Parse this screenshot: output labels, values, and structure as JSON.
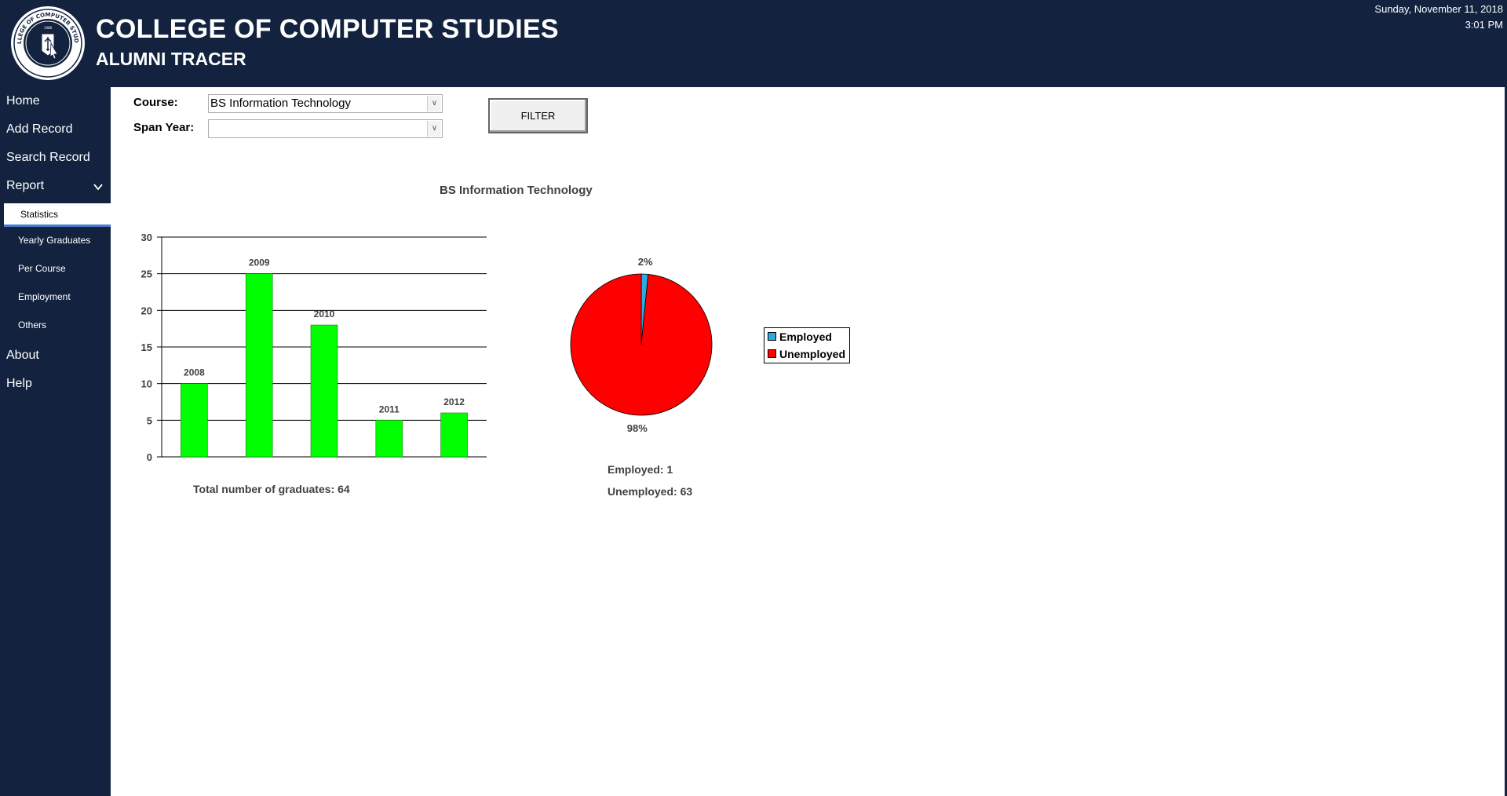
{
  "header": {
    "title": "COLLEGE OF COMPUTER STUDIES",
    "subtitle": "ALUMNI TRACER",
    "date": "Sunday, November 11, 2018",
    "time": "3:01 PM",
    "logo_text": "COLLEGE OF COMPUTER STUDIES",
    "logo_year": "1988"
  },
  "sidebar": {
    "items": [
      {
        "label": "Home"
      },
      {
        "label": "Add Record"
      },
      {
        "label": "Search Record"
      },
      {
        "label": "Report"
      },
      {
        "label": "About"
      },
      {
        "label": "Help"
      }
    ],
    "report_sub": [
      {
        "label": "Statistics"
      },
      {
        "label": "Yearly Graduates"
      },
      {
        "label": "Per Course"
      },
      {
        "label": "Employment"
      },
      {
        "label": "Others"
      }
    ]
  },
  "filter": {
    "course_label": "Course:",
    "course_value": "BS Information Technology",
    "span_label": "Span Year:",
    "span_value": "",
    "button_label": "FILTER"
  },
  "report": {
    "title": "BS Information Technology",
    "total_text": "Total number of graduates: 64",
    "employed_text": "Employed: 1",
    "unemployed_text": "Unemployed: 63"
  },
  "chart_data": [
    {
      "type": "bar",
      "title": "",
      "categories": [
        "2008",
        "2009",
        "2010",
        "2011",
        "2012"
      ],
      "values": [
        10,
        25,
        18,
        5,
        6
      ],
      "ylim": [
        0,
        30
      ],
      "yticks": [
        0,
        5,
        10,
        15,
        20,
        25,
        30
      ],
      "grid": true,
      "color": "#00ff00"
    },
    {
      "type": "pie",
      "labels": [
        "Employed",
        "Unemployed"
      ],
      "values": [
        1,
        63
      ],
      "percent_labels": [
        "2%",
        "98%"
      ],
      "colors": [
        "#29abe2",
        "#ff0000"
      ],
      "legend": "right"
    }
  ]
}
